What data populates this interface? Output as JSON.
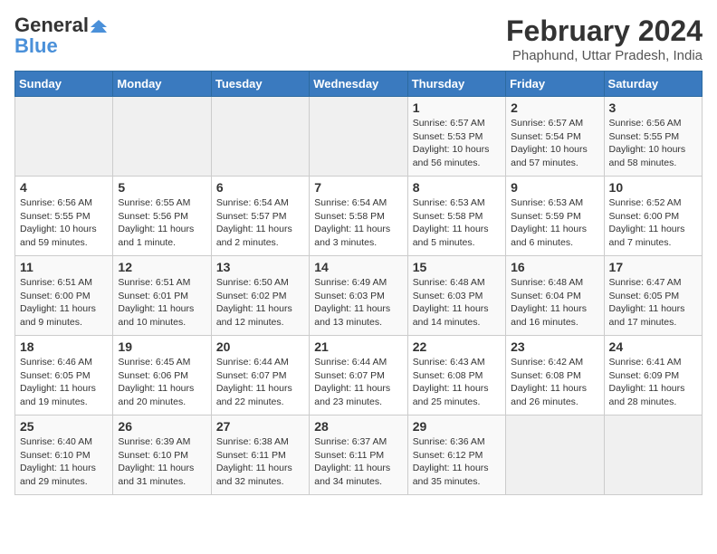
{
  "header": {
    "logo_line1": "General",
    "logo_line2": "Blue",
    "main_title": "February 2024",
    "subtitle": "Phaphund, Uttar Pradesh, India"
  },
  "days_of_week": [
    "Sunday",
    "Monday",
    "Tuesday",
    "Wednesday",
    "Thursday",
    "Friday",
    "Saturday"
  ],
  "weeks": [
    [
      {
        "day": "",
        "info": ""
      },
      {
        "day": "",
        "info": ""
      },
      {
        "day": "",
        "info": ""
      },
      {
        "day": "",
        "info": ""
      },
      {
        "day": "1",
        "info": "Sunrise: 6:57 AM\nSunset: 5:53 PM\nDaylight: 10 hours and 56 minutes."
      },
      {
        "day": "2",
        "info": "Sunrise: 6:57 AM\nSunset: 5:54 PM\nDaylight: 10 hours and 57 minutes."
      },
      {
        "day": "3",
        "info": "Sunrise: 6:56 AM\nSunset: 5:55 PM\nDaylight: 10 hours and 58 minutes."
      }
    ],
    [
      {
        "day": "4",
        "info": "Sunrise: 6:56 AM\nSunset: 5:55 PM\nDaylight: 10 hours and 59 minutes."
      },
      {
        "day": "5",
        "info": "Sunrise: 6:55 AM\nSunset: 5:56 PM\nDaylight: 11 hours and 1 minute."
      },
      {
        "day": "6",
        "info": "Sunrise: 6:54 AM\nSunset: 5:57 PM\nDaylight: 11 hours and 2 minutes."
      },
      {
        "day": "7",
        "info": "Sunrise: 6:54 AM\nSunset: 5:58 PM\nDaylight: 11 hours and 3 minutes."
      },
      {
        "day": "8",
        "info": "Sunrise: 6:53 AM\nSunset: 5:58 PM\nDaylight: 11 hours and 5 minutes."
      },
      {
        "day": "9",
        "info": "Sunrise: 6:53 AM\nSunset: 5:59 PM\nDaylight: 11 hours and 6 minutes."
      },
      {
        "day": "10",
        "info": "Sunrise: 6:52 AM\nSunset: 6:00 PM\nDaylight: 11 hours and 7 minutes."
      }
    ],
    [
      {
        "day": "11",
        "info": "Sunrise: 6:51 AM\nSunset: 6:00 PM\nDaylight: 11 hours and 9 minutes."
      },
      {
        "day": "12",
        "info": "Sunrise: 6:51 AM\nSunset: 6:01 PM\nDaylight: 11 hours and 10 minutes."
      },
      {
        "day": "13",
        "info": "Sunrise: 6:50 AM\nSunset: 6:02 PM\nDaylight: 11 hours and 12 minutes."
      },
      {
        "day": "14",
        "info": "Sunrise: 6:49 AM\nSunset: 6:03 PM\nDaylight: 11 hours and 13 minutes."
      },
      {
        "day": "15",
        "info": "Sunrise: 6:48 AM\nSunset: 6:03 PM\nDaylight: 11 hours and 14 minutes."
      },
      {
        "day": "16",
        "info": "Sunrise: 6:48 AM\nSunset: 6:04 PM\nDaylight: 11 hours and 16 minutes."
      },
      {
        "day": "17",
        "info": "Sunrise: 6:47 AM\nSunset: 6:05 PM\nDaylight: 11 hours and 17 minutes."
      }
    ],
    [
      {
        "day": "18",
        "info": "Sunrise: 6:46 AM\nSunset: 6:05 PM\nDaylight: 11 hours and 19 minutes."
      },
      {
        "day": "19",
        "info": "Sunrise: 6:45 AM\nSunset: 6:06 PM\nDaylight: 11 hours and 20 minutes."
      },
      {
        "day": "20",
        "info": "Sunrise: 6:44 AM\nSunset: 6:07 PM\nDaylight: 11 hours and 22 minutes."
      },
      {
        "day": "21",
        "info": "Sunrise: 6:44 AM\nSunset: 6:07 PM\nDaylight: 11 hours and 23 minutes."
      },
      {
        "day": "22",
        "info": "Sunrise: 6:43 AM\nSunset: 6:08 PM\nDaylight: 11 hours and 25 minutes."
      },
      {
        "day": "23",
        "info": "Sunrise: 6:42 AM\nSunset: 6:08 PM\nDaylight: 11 hours and 26 minutes."
      },
      {
        "day": "24",
        "info": "Sunrise: 6:41 AM\nSunset: 6:09 PM\nDaylight: 11 hours and 28 minutes."
      }
    ],
    [
      {
        "day": "25",
        "info": "Sunrise: 6:40 AM\nSunset: 6:10 PM\nDaylight: 11 hours and 29 minutes."
      },
      {
        "day": "26",
        "info": "Sunrise: 6:39 AM\nSunset: 6:10 PM\nDaylight: 11 hours and 31 minutes."
      },
      {
        "day": "27",
        "info": "Sunrise: 6:38 AM\nSunset: 6:11 PM\nDaylight: 11 hours and 32 minutes."
      },
      {
        "day": "28",
        "info": "Sunrise: 6:37 AM\nSunset: 6:11 PM\nDaylight: 11 hours and 34 minutes."
      },
      {
        "day": "29",
        "info": "Sunrise: 6:36 AM\nSunset: 6:12 PM\nDaylight: 11 hours and 35 minutes."
      },
      {
        "day": "",
        "info": ""
      },
      {
        "day": "",
        "info": ""
      }
    ]
  ]
}
